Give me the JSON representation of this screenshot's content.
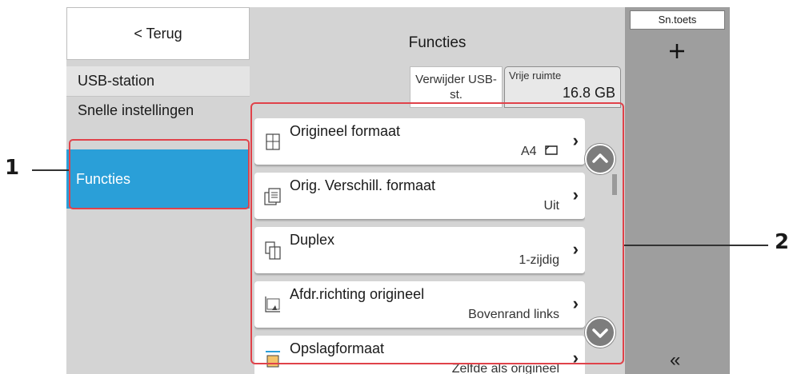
{
  "sidebar": {
    "back_label": "< Terug",
    "items": [
      {
        "label": "USB-station"
      },
      {
        "label": "Snelle instellingen"
      },
      {
        "label": "Functies"
      }
    ]
  },
  "main": {
    "title": "Functies",
    "delete_button": "Verwijder USB-st.",
    "free_space_label": "Vrije ruimte",
    "free_space_value": "16.8 GB"
  },
  "rows": [
    {
      "label": "Origineel formaat",
      "value": "A4",
      "icon": "original-size-icon"
    },
    {
      "label": "Orig. Verschill. formaat",
      "value": "Uit",
      "icon": "mixed-size-icon"
    },
    {
      "label": "Duplex",
      "value": "1-zijdig",
      "icon": "duplex-icon"
    },
    {
      "label": "Afdr.richting origineel",
      "value": "Bovenrand links",
      "icon": "orientation-icon"
    },
    {
      "label": "Opslagformaat",
      "value": "Zelfde als origineel",
      "icon": "storing-size-icon"
    }
  ],
  "right_panel": {
    "shortcut_label": "Sn.toets",
    "add_icon": "plus-icon",
    "collapse_icon": "double-chevron-left-icon"
  },
  "callouts": {
    "left": "1",
    "right": "2"
  },
  "colors": {
    "accent": "#2a9fd8",
    "highlight": "#e0424a",
    "panel": "#d4d4d4",
    "right_panel": "#9e9e9e"
  }
}
